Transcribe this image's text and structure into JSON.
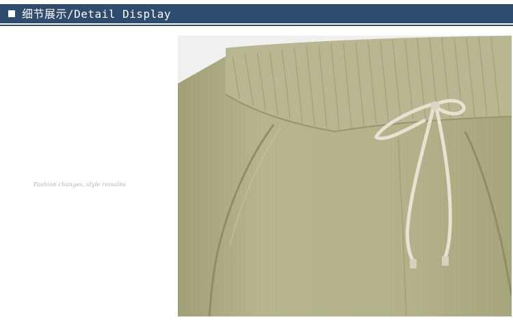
{
  "header": {
    "title": "细节展示/Detail Display"
  },
  "tagline": "Fashion changes, style remains",
  "photo": {
    "icon": "product-photo",
    "fabric_color": "#b1b088",
    "drawstring_color": "#eae1d2"
  }
}
